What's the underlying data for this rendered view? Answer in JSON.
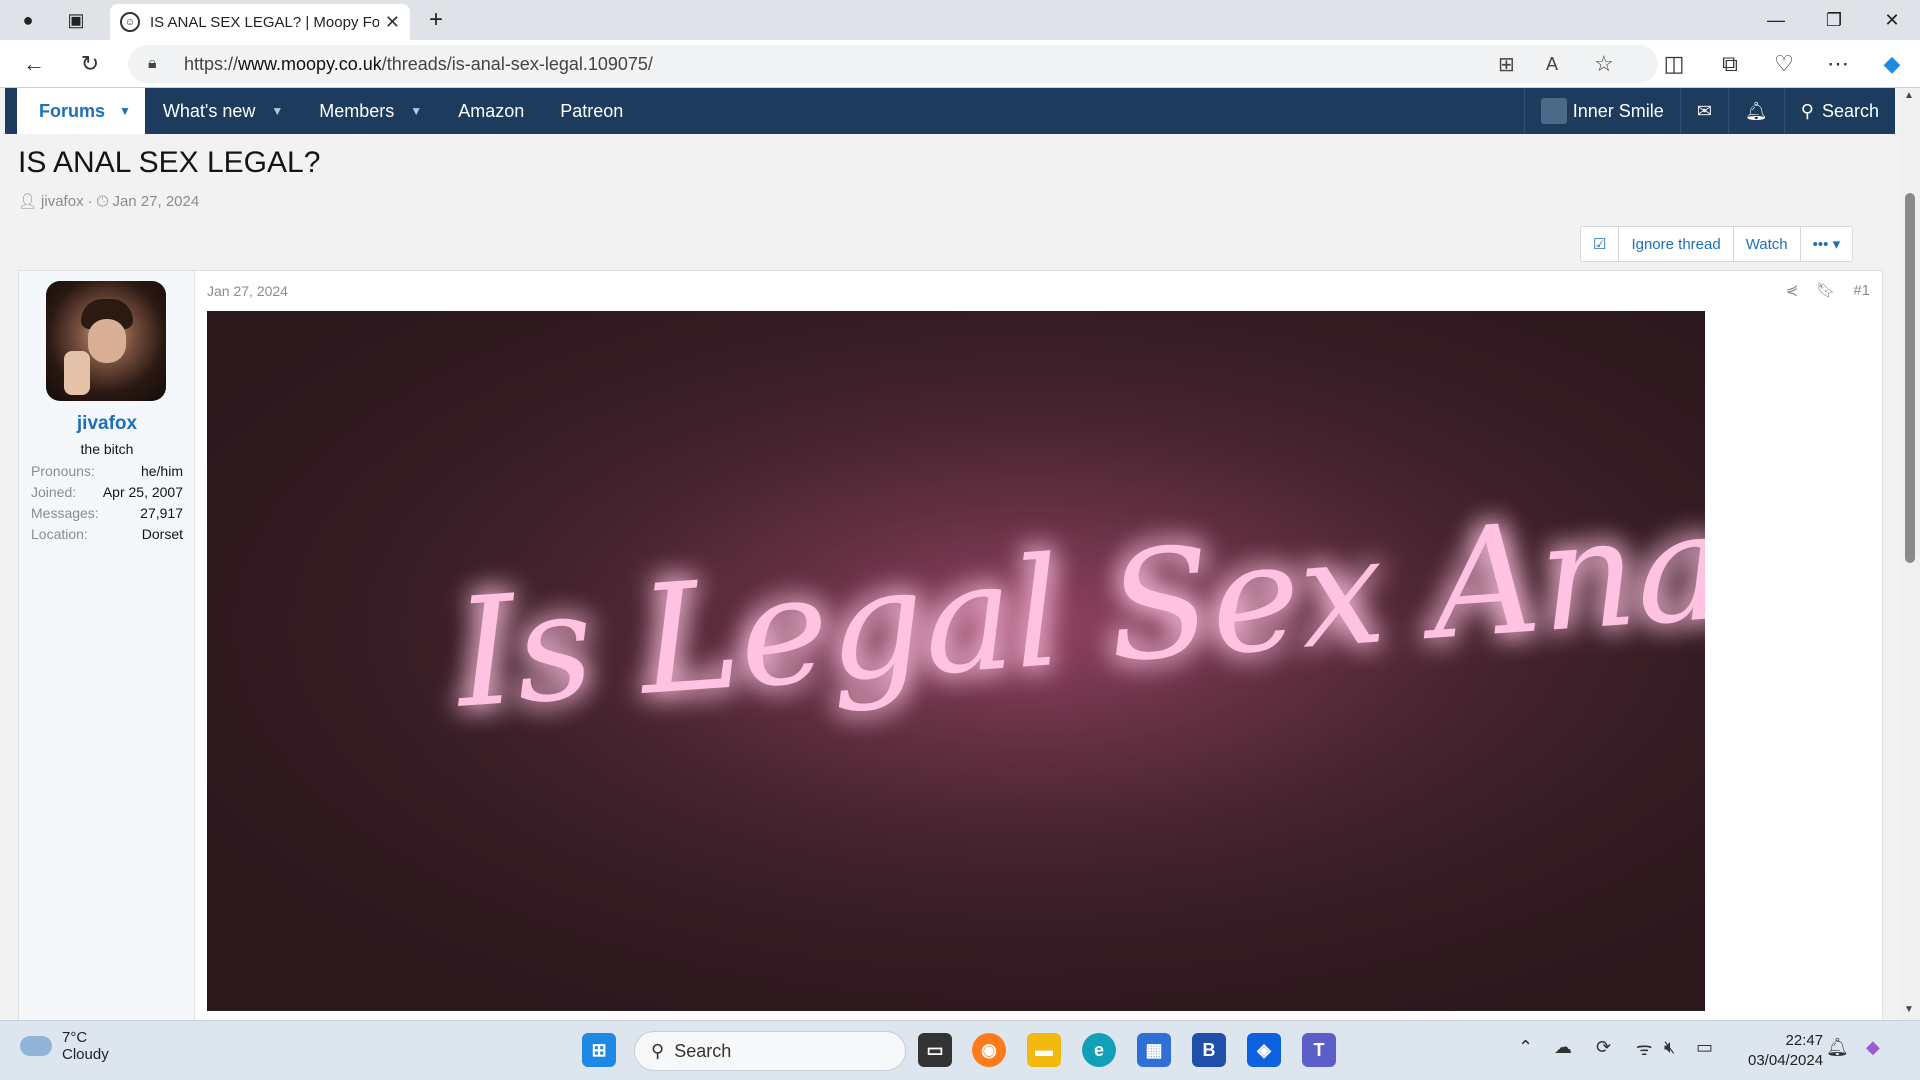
{
  "browser": {
    "tab_title": "IS ANAL SEX LEGAL? | Moopy For",
    "url_prefix": "https://",
    "url_host": "www.moopy.co.uk",
    "url_path": "/threads/is-anal-sex-legal.109075/"
  },
  "nav": {
    "forums": "Forums",
    "whats_new": "What's new",
    "members": "Members",
    "amazon": "Amazon",
    "patreon": "Patreon",
    "user": "Inner Smile",
    "search": "Search"
  },
  "thread": {
    "title": "IS ANAL SEX LEGAL?",
    "author": "jivafox",
    "sep": "·",
    "date": "Jan 27, 2024",
    "actions": {
      "ignore": "Ignore thread",
      "watch": "Watch",
      "more": "•••"
    }
  },
  "post": {
    "date": "Jan 27, 2024",
    "number": "#1",
    "user": {
      "name": "jivafox",
      "title": "the bitch",
      "stats": [
        {
          "k": "Pronouns:",
          "v": "he/him"
        },
        {
          "k": "Joined:",
          "v": "Apr 25, 2007"
        },
        {
          "k": "Messages:",
          "v": "27,917"
        },
        {
          "k": "Location:",
          "v": "Dorset"
        }
      ]
    },
    "image_text": "Is Legal Sex Anal?"
  },
  "taskbar": {
    "temp": "7°C",
    "condition": "Cloudy",
    "search": "Search",
    "time": "22:47",
    "date": "03/04/2024"
  },
  "colors": {
    "nav_bg": "#1d3b5c",
    "link": "#1d6fb8",
    "neon": "#ffb3d9"
  }
}
